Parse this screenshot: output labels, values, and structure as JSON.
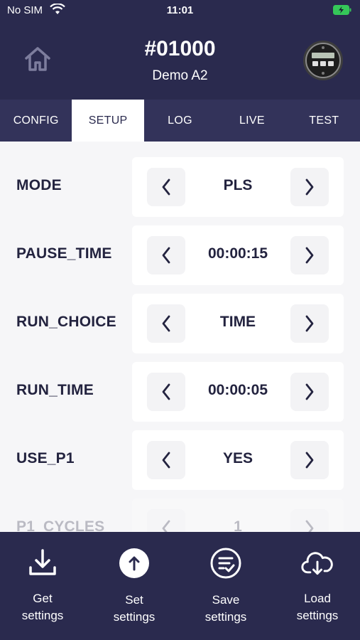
{
  "status_bar": {
    "carrier": "No SIM",
    "time": "11:01"
  },
  "header": {
    "device_id": "#01000",
    "device_name": "Demo A2"
  },
  "tabs": [
    {
      "label": "CONFIG",
      "active": false
    },
    {
      "label": "SETUP",
      "active": true
    },
    {
      "label": "LOG",
      "active": false
    },
    {
      "label": "LIVE",
      "active": false
    },
    {
      "label": "TEST",
      "active": false
    }
  ],
  "settings": [
    {
      "label": "MODE",
      "value": "PLS"
    },
    {
      "label": "PAUSE_TIME",
      "value": "00:00:15"
    },
    {
      "label": "RUN_CHOICE",
      "value": "TIME"
    },
    {
      "label": "RUN_TIME",
      "value": "00:00:05"
    },
    {
      "label": "USE_P1",
      "value": "YES"
    },
    {
      "label": "P1_CYCLES",
      "value": "1"
    }
  ],
  "actions": [
    {
      "line1": "Get",
      "line2": "settings",
      "icon": "download-icon"
    },
    {
      "line1": "Set",
      "line2": "settings",
      "icon": "upload-circle-icon"
    },
    {
      "line1": "Save",
      "line2": "settings",
      "icon": "save-list-icon"
    },
    {
      "line1": "Load",
      "line2": "settings",
      "icon": "cloud-download-icon"
    }
  ],
  "colors": {
    "header_bg": "#2a2a4e",
    "tab_bg": "#33335a",
    "text_dark": "#23233f",
    "battery": "#35c759"
  }
}
